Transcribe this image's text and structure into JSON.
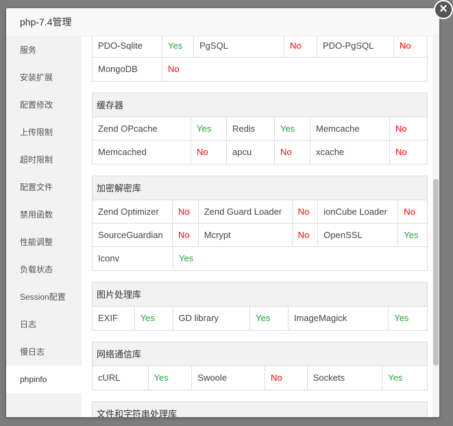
{
  "window": {
    "title": "php-7.4管理",
    "close_icon": "close-icon"
  },
  "sidebar": {
    "items": [
      {
        "label": "服务"
      },
      {
        "label": "安装扩展"
      },
      {
        "label": "配置修改"
      },
      {
        "label": "上传限制"
      },
      {
        "label": "超时限制"
      },
      {
        "label": "配置文件"
      },
      {
        "label": "禁用函数"
      },
      {
        "label": "性能调整"
      },
      {
        "label": "负载状态"
      },
      {
        "label": "Session配置"
      },
      {
        "label": "日志"
      },
      {
        "label": "慢日志"
      },
      {
        "label": "phpinfo"
      }
    ],
    "active_index": 12
  },
  "sections": [
    {
      "title": "",
      "rows": [
        [
          {
            "n": "PDO-Sqlite",
            "v": "Yes"
          },
          {
            "n": "PgSQL",
            "v": "No"
          },
          {
            "n": "PDO-PgSQL",
            "v": "No"
          }
        ],
        [
          {
            "n": "MongoDB",
            "v": "No"
          }
        ]
      ]
    },
    {
      "title": "缓存器",
      "rows": [
        [
          {
            "n": "Zend OPcache",
            "v": "Yes"
          },
          {
            "n": "Redis",
            "v": "Yes"
          },
          {
            "n": "Memcache",
            "v": "No"
          }
        ],
        [
          {
            "n": "Memcached",
            "v": "No"
          },
          {
            "n": "apcu",
            "v": "No"
          },
          {
            "n": "xcache",
            "v": "No"
          }
        ]
      ]
    },
    {
      "title": "加密解密库",
      "rows": [
        [
          {
            "n": "Zend Optimizer",
            "v": "No"
          },
          {
            "n": "Zend Guard Loader",
            "v": "No"
          },
          {
            "n": "ionCube Loader",
            "v": "No"
          }
        ],
        [
          {
            "n": "SourceGuardian",
            "v": "No"
          },
          {
            "n": "Mcrypt",
            "v": "No"
          },
          {
            "n": "OpenSSL",
            "v": "Yes"
          }
        ],
        [
          {
            "n": "Iconv",
            "v": "Yes"
          }
        ]
      ]
    },
    {
      "title": "图片处理库",
      "rows": [
        [
          {
            "n": "EXIF",
            "v": "Yes"
          },
          {
            "n": "GD library",
            "v": "Yes"
          },
          {
            "n": "ImageMagick",
            "v": "Yes"
          }
        ]
      ]
    },
    {
      "title": "网络通信库",
      "rows": [
        [
          {
            "n": "cURL",
            "v": "Yes"
          },
          {
            "n": "Swoole",
            "v": "No"
          },
          {
            "n": "Sockets",
            "v": "Yes"
          }
        ]
      ]
    },
    {
      "title": "文件和字符串处理库",
      "rows": []
    }
  ],
  "colors": {
    "yes": "#20a53a",
    "no": "#ff0000"
  }
}
